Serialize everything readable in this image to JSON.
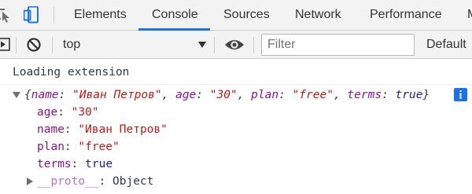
{
  "tabs": {
    "items": [
      {
        "label": "Elements"
      },
      {
        "label": "Console",
        "active": true
      },
      {
        "label": "Sources"
      },
      {
        "label": "Network"
      },
      {
        "label": "Performance"
      },
      {
        "label": "M"
      }
    ],
    "accent_color": "#1a73e8"
  },
  "toolbar": {
    "context_value": "top",
    "filter_placeholder": "Filter",
    "levels_label": "Default"
  },
  "console": {
    "log_message": "Loading extension",
    "object_preview": {
      "open": "{",
      "entries": [
        {
          "key": "name",
          "value": "\"Иван Петров\"",
          "sep": ", "
        },
        {
          "key": "age",
          "value": "\"30\"",
          "sep": ", "
        },
        {
          "key": "plan",
          "value": "\"free\"",
          "sep": ", "
        },
        {
          "key": "terms",
          "value": "true",
          "sep": ""
        }
      ],
      "close": "}"
    },
    "properties": [
      {
        "key": "age",
        "value": "\"30\"",
        "kind": "string"
      },
      {
        "key": "name",
        "value": "\"Иван Петров\"",
        "kind": "string"
      },
      {
        "key": "plan",
        "value": "\"free\"",
        "kind": "string"
      },
      {
        "key": "terms",
        "value": "true",
        "kind": "boolean"
      }
    ],
    "proto": {
      "key": "__proto__",
      "value": "Object"
    },
    "colors": {
      "property": "#881391",
      "string": "#c41a16",
      "boolean": "#1a1aa6",
      "proto": "#b774c0"
    }
  }
}
